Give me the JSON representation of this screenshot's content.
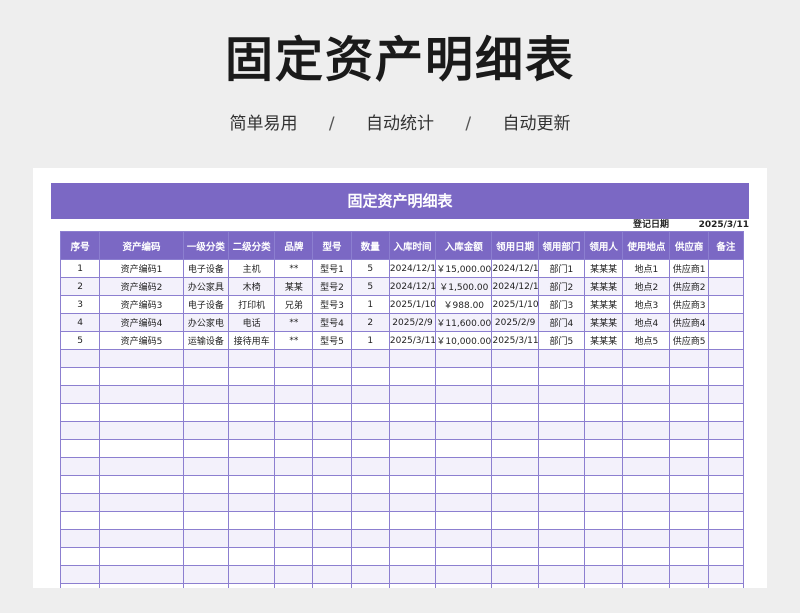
{
  "page": {
    "title": "固定资产明细表",
    "features": [
      "简单易用",
      "自动统计",
      "自动更新"
    ],
    "separator": "/"
  },
  "sheet": {
    "header": "固定资产明细表",
    "register_label": "登记日期",
    "register_date": "2025/3/11",
    "columns": [
      "序号",
      "资产编码",
      "一级分类",
      "二级分类",
      "品牌",
      "型号",
      "数量",
      "入库时间",
      "入库金额",
      "领用日期",
      "领用部门",
      "领用人",
      "使用地点",
      "供应商",
      "备注"
    ],
    "rows": [
      [
        "1",
        "资产编码1",
        "电子设备",
        "主机",
        "**",
        "型号1",
        "5",
        "2024/12/11",
        "￥15,000.00",
        "2024/12/11",
        "部门1",
        "某某某",
        "地点1",
        "供应商1",
        ""
      ],
      [
        "2",
        "资产编码2",
        "办公家具",
        "木椅",
        "某某",
        "型号2",
        "5",
        "2024/12/11",
        "￥1,500.00",
        "2024/12/11",
        "部门2",
        "某某某",
        "地点2",
        "供应商2",
        ""
      ],
      [
        "3",
        "资产编码3",
        "电子设备",
        "打印机",
        "兄弟",
        "型号3",
        "1",
        "2025/1/10",
        "￥988.00",
        "2025/1/10",
        "部门3",
        "某某某",
        "地点3",
        "供应商3",
        ""
      ],
      [
        "4",
        "资产编码4",
        "办公家电",
        "电话",
        "**",
        "型号4",
        "2",
        "2025/2/9",
        "￥11,600.00",
        "2025/2/9",
        "部门4",
        "某某某",
        "地点4",
        "供应商4",
        ""
      ],
      [
        "5",
        "资产编码5",
        "运输设备",
        "接待用车",
        "**",
        "型号5",
        "1",
        "2025/3/11",
        "￥10,000.00",
        "2025/3/11",
        "部门5",
        "某某某",
        "地点5",
        "供应商5",
        ""
      ]
    ],
    "accent_color": "#7b68c4"
  }
}
